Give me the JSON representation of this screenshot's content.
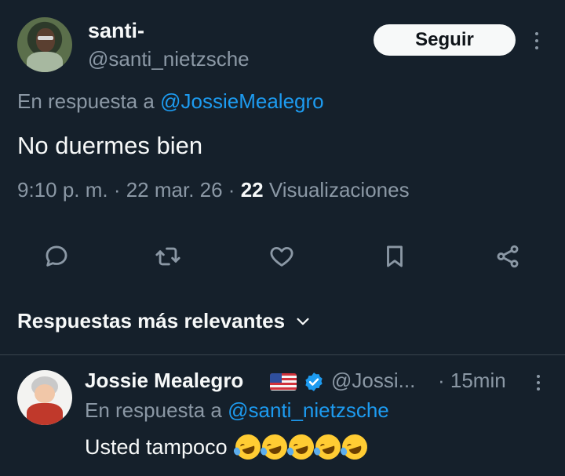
{
  "tweet": {
    "author_name": "santi-",
    "author_handle": "@santi_nietzsche",
    "follow_label": "Seguir",
    "reply_prefix": "En respuesta a ",
    "reply_to_handle": "@JossieMealegro",
    "text": "No duermes bien",
    "time": "9:10 p. m. · 22 mar. 26 · ",
    "views_count": "22",
    "views_label": " Visualizaciones"
  },
  "actions": {
    "reply_icon": "comment-icon",
    "retweet_icon": "retweet-icon",
    "like_icon": "heart-icon",
    "bookmark_icon": "bookmark-icon",
    "share_icon": "share-icon"
  },
  "replies_section": {
    "sort_label": "Respuestas más relevantes"
  },
  "reply": {
    "author_name": "Jossie Mealegro",
    "flag": "us-flag",
    "author_handle": "@Jossi...",
    "time": "· 15min",
    "reply_prefix": "En respuesta a ",
    "reply_to_handle": "@santi_nietzsche",
    "text": "Usted tampoco",
    "emoji": "rolling-on-floor-laughing",
    "emoji_count": 5
  },
  "colors": {
    "background": "#15202b",
    "text": "#f7f9f9",
    "muted": "#8b98a5",
    "link": "#1d9bf0",
    "divider": "#38444d"
  }
}
